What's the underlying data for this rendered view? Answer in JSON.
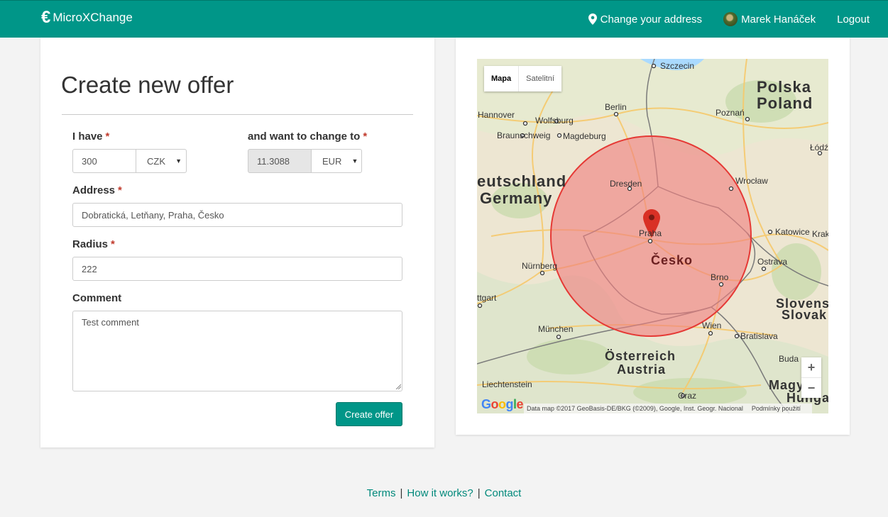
{
  "app": {
    "brand_symbol": "€",
    "brand_name": "MicroXChange"
  },
  "nav": {
    "change_address": "Change your address",
    "user_name": "Marek Hanáček",
    "logout": "Logout"
  },
  "form": {
    "title": "Create new offer",
    "have_label": "I have",
    "have_amount": "300",
    "have_currency": "CZK",
    "want_label": "and want to change to",
    "want_amount": "11.3088",
    "want_currency": "EUR",
    "address_label": "Address",
    "address_value": "Dobratická, Letňany, Praha, Česko",
    "radius_label": "Radius",
    "radius_value": "222",
    "comment_label": "Comment",
    "comment_value": "Test comment",
    "required_marker": "*",
    "submit": "Create offer"
  },
  "map": {
    "type_map": "Mapa",
    "type_satellite": "Satelitní",
    "zoom_in": "+",
    "zoom_out": "−",
    "attribution": "Data map ©2017 GeoBasis-DE/BKG (©2009), Google, Inst. Geogr. Nacional",
    "terms": "Podmínky použití",
    "google_logo": "Google",
    "labels": {
      "szczecin": "Szczecin",
      "polska": "Polska",
      "poland": "Poland",
      "berlin": "Berlin",
      "poznan": "Poznań",
      "hannover": "Hannover",
      "wolfsburg": "Wolfsburg",
      "braunschweig": "Braunschweig",
      "magdeburg": "Magdeburg",
      "lodz": "Łódź",
      "deutschland": "eutschland",
      "germany": "Germany",
      "dresden": "Dresden",
      "wroclaw": "Wrocław",
      "praha": "Praha",
      "katowice": "Katowice",
      "krak": "Krak",
      "cesko": "Česko",
      "nurnberg": "Nürnberg",
      "ostrava": "Ostrava",
      "brno": "Brno",
      "ttgart": "ttgart",
      "slovens": "Slovens",
      "slovak": "Slovak",
      "munchen": "München",
      "wien": "Wien",
      "bratislava": "Bratislava",
      "osterreich": "Österreich",
      "austria": "Austria",
      "buda": "Buda",
      "liechtenstein": "Liechtenstein",
      "graz": "Graz",
      "magy": "Magy",
      "hunga": "Hunga"
    },
    "colors": {
      "circle_fill": "#f08080",
      "circle_stroke": "#e53935",
      "marker": "#d93025"
    }
  },
  "footer": {
    "terms": "Terms",
    "how": "How it works?",
    "contact": "Contact",
    "separator": "|"
  },
  "colors": {
    "primary": "#009688",
    "link": "#00897b",
    "required": "#c0392b"
  }
}
